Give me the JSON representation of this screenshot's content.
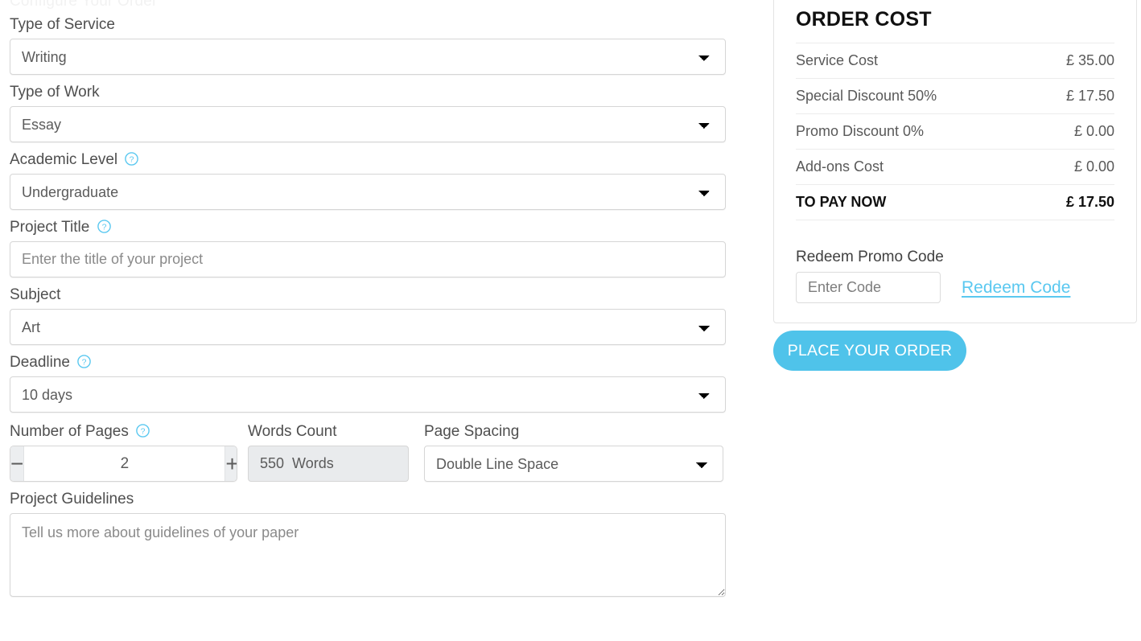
{
  "clipped_top_text": "Configure Your Order",
  "form": {
    "fields": [
      {
        "label": "Type of Service",
        "value": "Writing",
        "help": false,
        "type": "select"
      },
      {
        "label": "Type of Work",
        "value": "Essay",
        "help": false,
        "type": "select"
      },
      {
        "label": "Academic Level",
        "value": "Undergraduate",
        "help": true,
        "type": "select"
      },
      {
        "label": "Project Title",
        "value": "",
        "placeholder": "Enter the title of your project",
        "help": true,
        "type": "text"
      },
      {
        "label": "Subject",
        "value": "Art",
        "help": false,
        "type": "select"
      },
      {
        "label": "Deadline",
        "value": "10 days",
        "help": true,
        "type": "select"
      }
    ],
    "pages": {
      "label": "Number of Pages",
      "help": true,
      "value": "2",
      "decrement_label": "−",
      "increment_label": "+"
    },
    "words": {
      "label": "Words Count",
      "value": "550  Words"
    },
    "spacing": {
      "label": "Page Spacing",
      "value": "Double Line Space"
    },
    "guidelines": {
      "label": "Project Guidelines",
      "value": "",
      "placeholder": "Tell us more about guidelines of your paper"
    }
  },
  "order_cost": {
    "title": "ORDER COST",
    "rows": [
      {
        "label": "Service Cost",
        "amount": "£ 35.00",
        "total": false
      },
      {
        "label": "Special Discount 50%",
        "amount": "£ 17.50",
        "total": false
      },
      {
        "label": "Promo Discount 0%",
        "amount": "£ 0.00",
        "total": false
      },
      {
        "label": "Add-ons Cost",
        "amount": "£ 0.00",
        "total": false
      },
      {
        "label": "TO PAY NOW",
        "amount": "£ 17.50",
        "total": true
      }
    ],
    "promo": {
      "title": "Redeem Promo Code",
      "input_placeholder": "Enter Code",
      "input_value": "",
      "redeem_label": "Redeem Code"
    }
  },
  "place_order_label": "PLACE YOUR ORDER",
  "colors": {
    "accent": "#4fc3ea",
    "link": "#5ac8f0",
    "help_icon": "#5ac8f0",
    "text": "#4f4f4f",
    "border": "#d6d6d6",
    "muted_bg": "#e9ebed"
  }
}
